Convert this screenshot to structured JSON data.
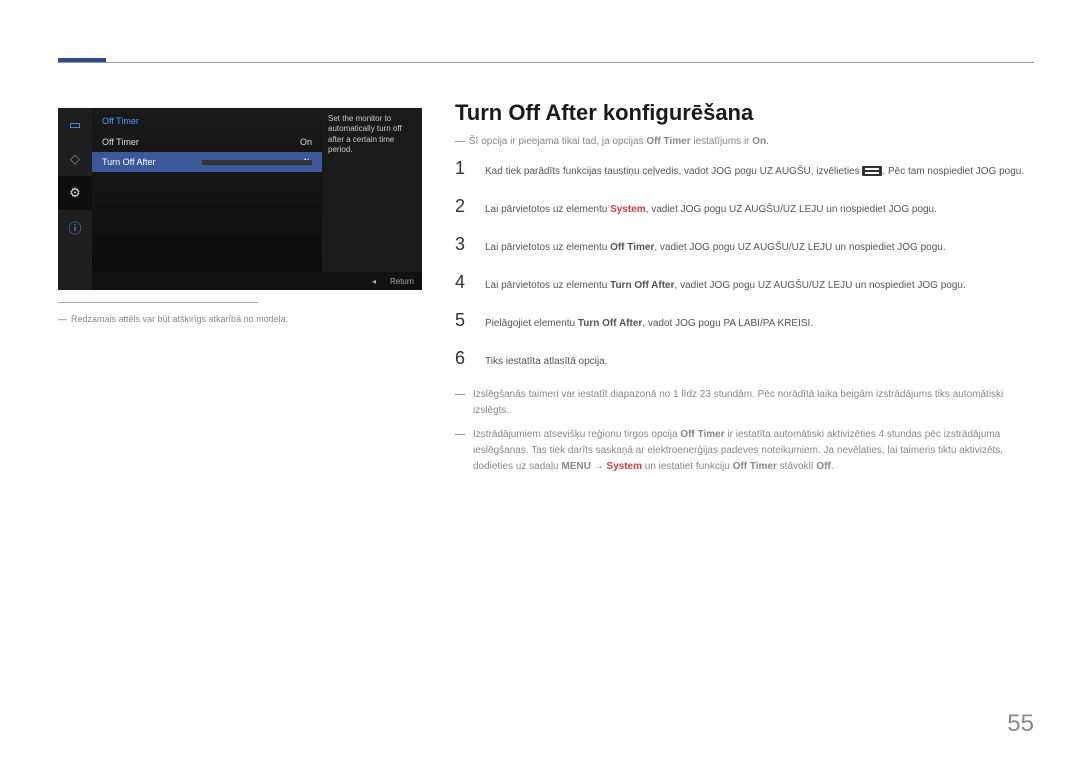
{
  "monitor": {
    "header": "Off Timer",
    "rows": [
      {
        "label": "Off Timer",
        "value": "On"
      },
      {
        "label": "Turn Off After",
        "value": "4h"
      }
    ],
    "description": "Set the monitor to automatically turn off after a certain time period.",
    "footer_return": "Return",
    "footer_arrow": "◂"
  },
  "caption": "Redzamais attēls var būt atšķirīgs atkarībā no modeļa.",
  "title": "Turn Off After konfigurēšana",
  "intro_note": {
    "pre": "Šī opcija ir pieejama tikai tad, ja opcijas ",
    "bold1": "Off Timer",
    "mid": " iestatījums ir ",
    "bold2": "On",
    "post": "."
  },
  "steps": {
    "s1_a": "Kad tiek parādīts funkcijas taustiņu ceļvedis, vadot JOG pogu UZ AUGŠU, izvēlieties ",
    "s1_b": ". Pēc tam nospiediet JOG pogu.",
    "s2_a": "Lai pārvietotos uz elementu ",
    "s2_red": "System",
    "s2_b": ", vadiet JOG pogu UZ AUGŠU/UZ LEJU un nospiediet JOG pogu.",
    "s3_a": "Lai pārvietotos uz elementu ",
    "s3_bold": "Off Timer",
    "s3_b": ", vadiet JOG pogu UZ AUGŠU/UZ LEJU un nospiediet JOG pogu.",
    "s4_a": "Lai pārvietotos uz elementu ",
    "s4_bold": "Turn Off After",
    "s4_b": ", vadiet JOG pogu UZ AUGŠU/UZ LEJU un nospiediet JOG pogu.",
    "s5_a": "Pielāgojiet elementu ",
    "s5_bold": "Turn Off After",
    "s5_b": ", vadot JOG pogu PA LABI/PA KREISI.",
    "s6": "Tiks iestatīta atlasītā opcija."
  },
  "notes": {
    "n1": "Izslēgšanās taimeri var iestatīt diapazonā no 1 līdz 23 stundām. Pēc norādītā laika beigām izstrādājums tiks automātiski izslēgts.",
    "n2_a": "Izstrādājumiem atsevišķu reģionu tirgos opcija ",
    "n2_bold1": "Off Timer",
    "n2_b": " ir iestatīta automātiski aktivizēties 4 stundas pēc izstrādājuma ieslēgšanas. Tas tiek darīts saskaņā ar elektroenerģijas padeves noteikumiem. Ja nevēlaties, lai taimeris tiktu aktivizēts, dodieties uz sadaļu ",
    "n2_bold2": "MENU",
    "n2_arrow": " → ",
    "n2_red": "System",
    "n2_c": " un iestatiet funkciju ",
    "n2_bold3": "Off Timer",
    "n2_d": " stāvoklī ",
    "n2_bold4": "Off",
    "n2_e": "."
  },
  "page": "55"
}
